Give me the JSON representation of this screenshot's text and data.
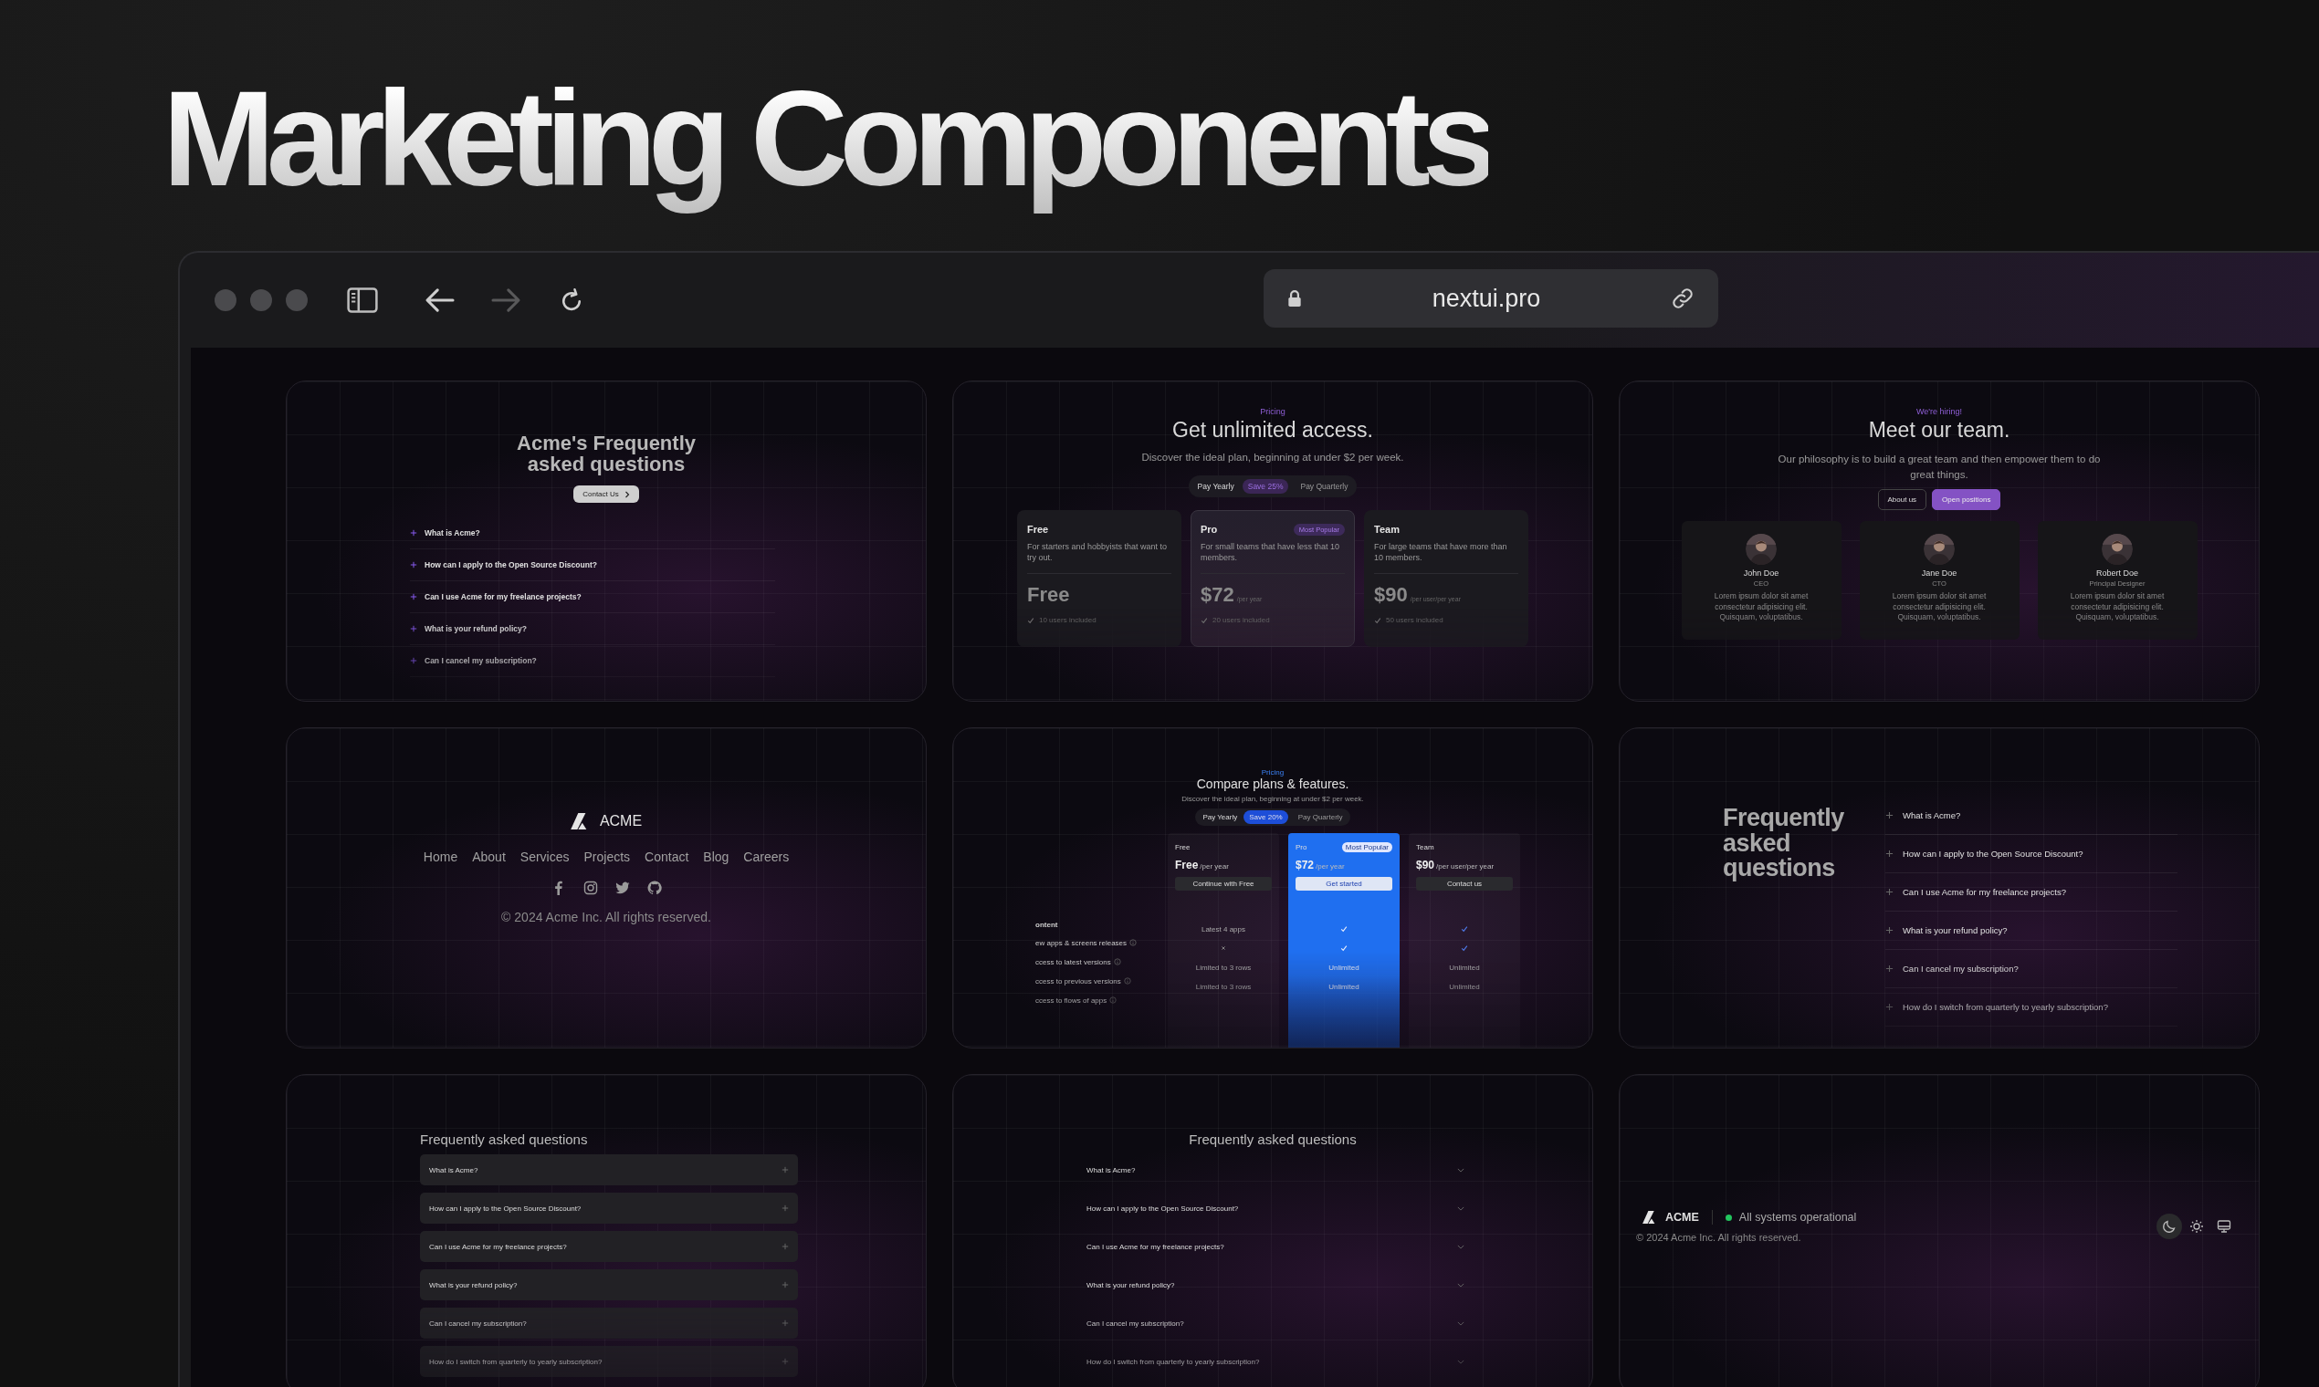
{
  "headline": "Marketing Components",
  "browser": {
    "url": "nextui.pro",
    "navigation": [
      {
        "kind": "back",
        "disabled": false
      },
      {
        "kind": "forward",
        "disabled": true
      },
      {
        "kind": "reload",
        "disabled": false
      }
    ]
  },
  "cards": [
    {
      "kind": "faq_center",
      "title": "Acme's Frequently asked questions",
      "button": "Contact Us",
      "questions": [
        "What is Acme?",
        "How can I apply to the Open Source Discount?",
        "Can I use Acme for my freelance projects?",
        "What is your refund policy?",
        "Can I cancel my subscription?"
      ]
    },
    {
      "kind": "pricing",
      "eyebrow": "Pricing",
      "title": "Get unlimited access.",
      "subtitle": "Discover the ideal plan, beginning at under $2 per week.",
      "toggle": [
        {
          "label": "Pay Yearly",
          "selected": true,
          "badge": "Save 25%"
        },
        {
          "label": "Pay Quarterly",
          "selected": false
        }
      ],
      "plans": [
        {
          "name": "Free",
          "description": "For starters and hobbyists that want to try out.",
          "price": "Free",
          "highlighted": false,
          "feature": "10 users included"
        },
        {
          "name": "Pro",
          "badge": "Most Popular",
          "description": "For small teams that have less that 10 members.",
          "price": "$72",
          "period": "/per year",
          "highlighted": true,
          "feature": "20 users included"
        },
        {
          "name": "Team",
          "description": "For large teams that have more than 10 members.",
          "price": "$90",
          "period": "/per user/per year",
          "highlighted": false,
          "feature": "50 users included"
        }
      ]
    },
    {
      "kind": "team",
      "eyebrow": "We're hiring!",
      "title": "Meet our team.",
      "subtitle": "Our philosophy is to build a great team and then empower them to do great things.",
      "buttons": [
        {
          "label": "About us",
          "primary": false
        },
        {
          "label": "Open positions",
          "primary": true
        }
      ],
      "members": [
        {
          "name": "John Doe",
          "role": "CEO",
          "bio": "Lorem ipsum dolor sit amet consectetur adipisicing elit. Quisquam, voluptatibus."
        },
        {
          "name": "Jane Doe",
          "role": "CTO",
          "bio": "Lorem ipsum dolor sit amet consectetur adipisicing elit. Quisquam, voluptatibus."
        },
        {
          "name": "Robert Doe",
          "role": "Principal Designer",
          "bio": "Lorem ipsum dolor sit amet consectetur adipisicing elit. Quisquam, voluptatibus."
        }
      ]
    },
    {
      "kind": "footer_center",
      "brand": "ACME",
      "links": [
        "Home",
        "About",
        "Services",
        "Projects",
        "Contact",
        "Blog",
        "Careers"
      ],
      "socials": [
        {
          "kind": "facebook"
        },
        {
          "kind": "instagram"
        },
        {
          "kind": "twitter"
        },
        {
          "kind": "github"
        }
      ],
      "copyright": "© 2024 Acme Inc. All rights reserved."
    },
    {
      "kind": "compare",
      "eyebrow": "Pricing",
      "title": "Compare plans & features.",
      "subtitle": "Discover the ideal plan, beginning at under $2 per week.",
      "toggle": [
        {
          "label": "Pay Yearly",
          "selected": true,
          "badge": "Save 20%"
        },
        {
          "label": "Pay Quarterly",
          "selected": false
        }
      ],
      "plans": [
        {
          "name": "Free",
          "price": "Free",
          "period": "/per year",
          "button": "Continue with Free",
          "highlighted": false
        },
        {
          "name": "Pro",
          "badge": "Most Popular",
          "price": "$72",
          "period": "/per year",
          "button": "Get started",
          "highlighted": true
        },
        {
          "name": "Team",
          "price": "$90",
          "period": "/per user/per year",
          "button": "Contact us",
          "highlighted": false
        }
      ],
      "section": "ontent",
      "rows": [
        {
          "label": "ew apps & screens releases",
          "values": [
            {
              "kind": "text",
              "text": "Latest 4 apps"
            },
            {
              "kind": "check"
            },
            {
              "kind": "check"
            }
          ]
        },
        {
          "label": "ccess to latest versions",
          "values": [
            {
              "kind": "cross"
            },
            {
              "kind": "check"
            },
            {
              "kind": "check"
            }
          ]
        },
        {
          "label": "ccess to previous versions",
          "values": [
            {
              "kind": "text",
              "text": "Limited to 3 rows"
            },
            {
              "kind": "text",
              "text": "Unlimited"
            },
            {
              "kind": "text",
              "text": "Unlimited"
            }
          ]
        },
        {
          "label": "ccess to flows of apps",
          "values": [
            {
              "kind": "text",
              "text": "Limited to 3 rows"
            },
            {
              "kind": "text",
              "text": "Unlimited"
            },
            {
              "kind": "text",
              "text": "Unlimited"
            }
          ]
        }
      ]
    },
    {
      "kind": "faq_split",
      "title": "Frequently asked questions",
      "questions": [
        "What is Acme?",
        "How can I apply to the Open Source Discount?",
        "Can I use Acme for my freelance projects?",
        "What is your refund policy?",
        "Can I cancel my subscription?",
        "How do I switch from quarterly to yearly subscription?"
      ]
    },
    {
      "kind": "faq_boxed",
      "title": "Frequently asked questions",
      "questions": [
        "What is Acme?",
        "How can I apply to the Open Source Discount?",
        "Can I use Acme for my freelance projects?",
        "What is your refund policy?",
        "Can I cancel my subscription?",
        "How do I switch from quarterly to yearly subscription?"
      ]
    },
    {
      "kind": "faq_chevron",
      "title": "Frequently asked questions",
      "questions": [
        "What is Acme?",
        "How can I apply to the Open Source Discount?",
        "Can I use Acme for my freelance projects?",
        "What is your refund policy?",
        "Can I cancel my subscription?",
        "How do I switch from quarterly to yearly subscription?"
      ]
    },
    {
      "kind": "footer_status",
      "brand": "ACME",
      "status": "All systems operational",
      "copyright": "© 2024 Acme Inc. All rights reserved.",
      "themes": [
        {
          "kind": "dark",
          "selected": true
        },
        {
          "kind": "light",
          "selected": false
        },
        {
          "kind": "system",
          "selected": false
        }
      ]
    }
  ]
}
